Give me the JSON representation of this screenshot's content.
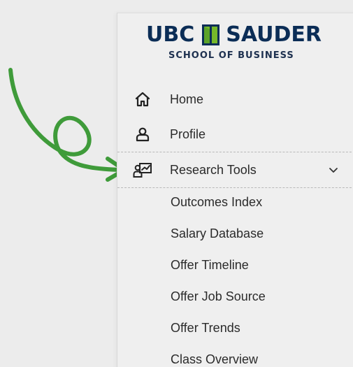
{
  "brand": {
    "left": "UBC",
    "right": "SAUDER",
    "subtitle": "SCHOOL OF BUSINESS",
    "primary_color": "#0b2d56",
    "accent_color": "#76b82a"
  },
  "nav": {
    "items": [
      {
        "label": "Home",
        "icon": "home-icon"
      },
      {
        "label": "Profile",
        "icon": "user-icon"
      },
      {
        "label": "Research Tools",
        "icon": "research-tools-icon",
        "expanded": true
      }
    ]
  },
  "submenu": {
    "items": [
      {
        "label": "Outcomes Index"
      },
      {
        "label": "Salary Database"
      },
      {
        "label": "Offer Timeline"
      },
      {
        "label": "Offer Job Source"
      },
      {
        "label": "Offer Trends"
      },
      {
        "label": "Class Overview"
      }
    ]
  },
  "annotation": {
    "arrow_color": "#3f9b3a"
  }
}
